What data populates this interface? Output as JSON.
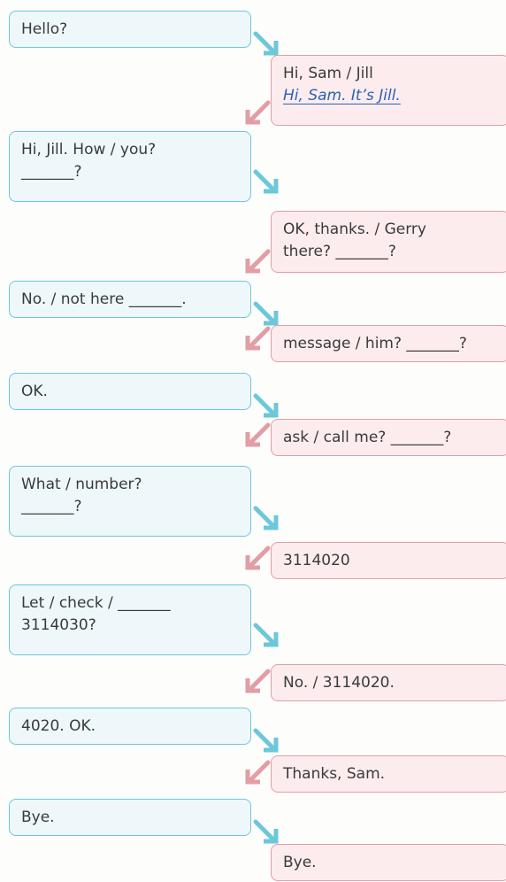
{
  "conversation": [
    {
      "speaker": "sam",
      "lines": [
        "Hello?"
      ]
    },
    {
      "speaker": "jill",
      "lines": [
        "Hi, Sam / Jill"
      ],
      "example": "Hi, Sam. It’s Jill."
    },
    {
      "speaker": "sam",
      "lines": [
        "Hi, Jill. How / you?",
        "_______?"
      ]
    },
    {
      "speaker": "jill",
      "lines": [
        "OK, thanks. / Gerry",
        "there? _______?"
      ]
    },
    {
      "speaker": "sam",
      "lines": [
        "No. / not here _______."
      ]
    },
    {
      "speaker": "jill",
      "lines": [
        "message / him? _______?"
      ]
    },
    {
      "speaker": "sam",
      "lines": [
        "OK."
      ]
    },
    {
      "speaker": "jill",
      "lines": [
        "ask / call me? _______?"
      ]
    },
    {
      "speaker": "sam",
      "lines": [
        "What / number?",
        "_______?"
      ]
    },
    {
      "speaker": "jill",
      "lines": [
        "3114020"
      ]
    },
    {
      "speaker": "sam",
      "lines": [
        "Let / check / _______",
        "3114030?"
      ]
    },
    {
      "speaker": "jill",
      "lines": [
        "No. / 3114020."
      ]
    },
    {
      "speaker": "sam",
      "lines": [
        "4020. OK."
      ]
    },
    {
      "speaker": "jill",
      "lines": [
        "Thanks, Sam."
      ]
    },
    {
      "speaker": "sam",
      "lines": [
        "Bye."
      ]
    },
    {
      "speaker": "jill",
      "lines": [
        "Bye."
      ]
    }
  ],
  "colors": {
    "sam_border": "#6cc7da",
    "sam_fill": "#eef8fb",
    "jill_border": "#e29da5",
    "jill_fill": "#fcecee",
    "example_text": "#2a62b8"
  },
  "icons": {
    "sam_arrow": "arrow-down-right-icon",
    "jill_arrow": "arrow-down-left-icon"
  }
}
